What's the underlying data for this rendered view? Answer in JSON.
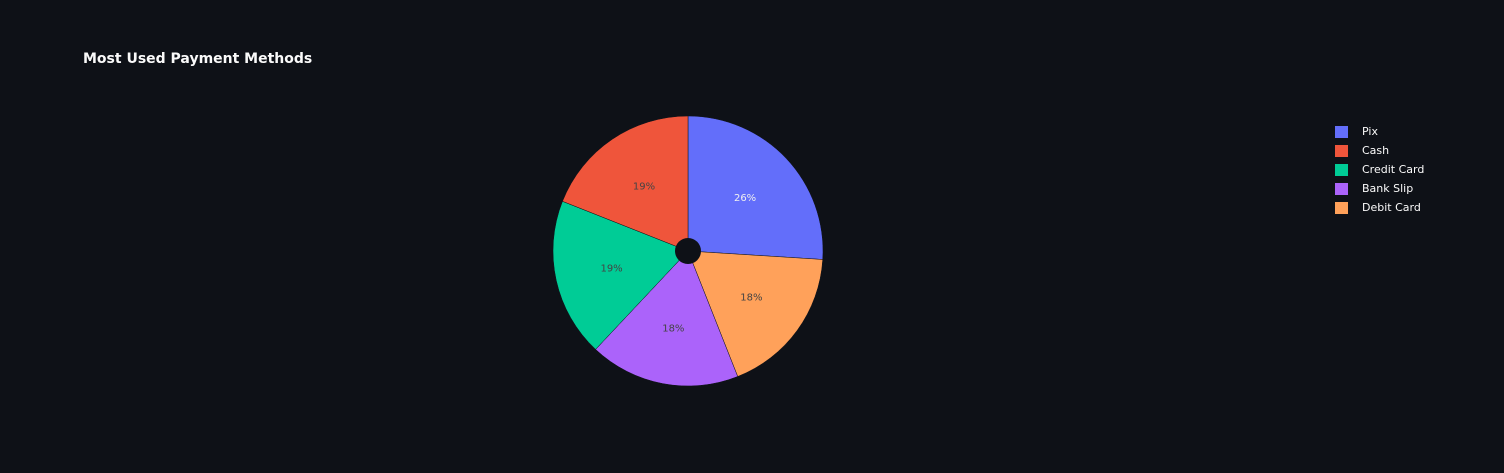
{
  "chart_data": {
    "type": "pie",
    "title": "Most Used Payment Methods",
    "categories": [
      "Pix",
      "Debit Card",
      "Bank Slip",
      "Credit Card",
      "Cash"
    ],
    "values": [
      26,
      18,
      18,
      19,
      19
    ],
    "labels": [
      "26%",
      "18%",
      "18%",
      "19%",
      "19%"
    ],
    "colors": [
      "#636efa",
      "#ffa15a",
      "#ab63fa",
      "#00cc96",
      "#ef553b"
    ],
    "label_colors": [
      "#f0f0f0",
      "#444444",
      "#444444",
      "#444444",
      "#444444"
    ],
    "legend": {
      "position": "right",
      "items": [
        {
          "label": "Pix",
          "color": "#636efa"
        },
        {
          "label": "Cash",
          "color": "#ef553b"
        },
        {
          "label": "Credit Card",
          "color": "#00cc96"
        },
        {
          "label": "Bank Slip",
          "color": "#ab63fa"
        },
        {
          "label": "Debit Card",
          "color": "#ffa15a"
        }
      ]
    },
    "direction": "clockwise",
    "hole": "small"
  }
}
